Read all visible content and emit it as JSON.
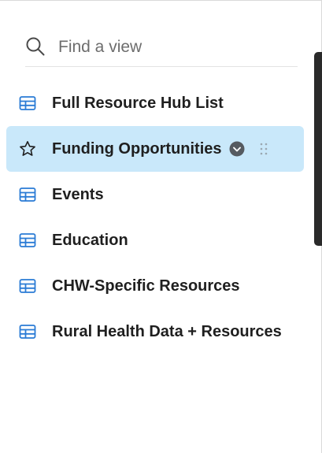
{
  "search": {
    "placeholder": "Find a view",
    "value": ""
  },
  "views": [
    {
      "label": "Full Resource Hub List",
      "icon": "grid-table-icon",
      "selected": false
    },
    {
      "label": "Funding Opportunities",
      "icon": "star-icon",
      "selected": true
    },
    {
      "label": "Events",
      "icon": "grid-table-icon",
      "selected": false
    },
    {
      "label": "Education",
      "icon": "grid-table-icon",
      "selected": false
    },
    {
      "label": "CHW-Specific Resources",
      "icon": "grid-table-icon",
      "selected": false
    },
    {
      "label": "Rural Health Data + Resources",
      "icon": "grid-table-icon",
      "selected": false
    }
  ],
  "colors": {
    "accent_icon": "#2a7bd5",
    "selected_bg": "#c9e8fa",
    "text": "#1f1f1f",
    "scrollbar": "#2a2a2a"
  }
}
